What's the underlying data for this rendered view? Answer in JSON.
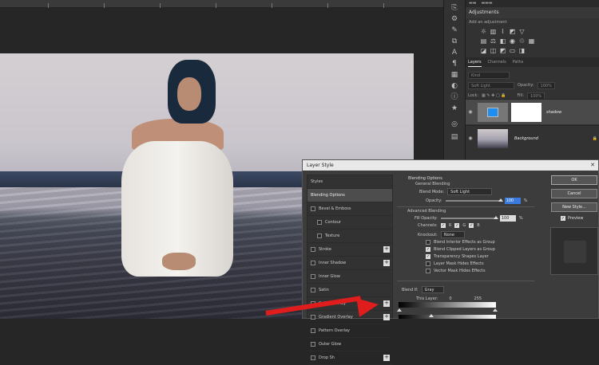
{
  "panels": {
    "adjustments_title": "Adjustments",
    "add_adjustment": "Add an adjustment",
    "layer_tabs": [
      "Layers",
      "Channels",
      "Paths"
    ],
    "filter_placeholder": "Kind",
    "blend_mode": "Soft Light",
    "opacity_label": "Opacity:",
    "opacity_value": "100%",
    "lock_label": "Lock:",
    "fill_label": "Fill:",
    "fill_value": "100%",
    "layers": [
      {
        "name": "shadow",
        "selected": true
      },
      {
        "name": "Background",
        "selected": false
      }
    ]
  },
  "dialog": {
    "title": "Layer Style",
    "styles": [
      {
        "label": "Styles",
        "type": "header"
      },
      {
        "label": "Blending Options",
        "type": "highlight"
      },
      {
        "label": "Bevel & Emboss",
        "type": "check"
      },
      {
        "label": "Contour",
        "type": "sub"
      },
      {
        "label": "Texture",
        "type": "sub"
      },
      {
        "label": "Stroke",
        "type": "check-plus"
      },
      {
        "label": "Inner Shadow",
        "type": "check-plus"
      },
      {
        "label": "Inner Glow",
        "type": "check"
      },
      {
        "label": "Satin",
        "type": "check"
      },
      {
        "label": "Color Overlay",
        "type": "check-plus"
      },
      {
        "label": "Gradient Overlay",
        "type": "check-plus"
      },
      {
        "label": "Pattern Overlay",
        "type": "check"
      },
      {
        "label": "Outer Glow",
        "type": "check"
      },
      {
        "label": "Drop Sh",
        "type": "check-plus"
      }
    ],
    "blending_options": "Blending Options",
    "general_blending": "General Blending",
    "blend_mode_label": "Blend Mode:",
    "blend_mode_value": "Soft Light",
    "opacity_label": "Opacity:",
    "opacity_value": "100",
    "opacity_pct": "%",
    "advanced_blending": "Advanced Blending",
    "fill_opacity_label": "Fill Opacity:",
    "fill_opacity_value": "100",
    "channels_label": "Channels:",
    "channels": [
      "R",
      "G",
      "B"
    ],
    "knockout_label": "Knockout:",
    "knockout_value": "None",
    "checks": [
      {
        "label": "Blend Interior Effects as Group",
        "checked": false
      },
      {
        "label": "Blend Clipped Layers as Group",
        "checked": true
      },
      {
        "label": "Transparency Shapes Layer",
        "checked": true
      },
      {
        "label": "Layer Mask Hides Effects",
        "checked": false
      },
      {
        "label": "Vector Mask Hides Effects",
        "checked": false
      }
    ],
    "blend_if_label": "Blend If:",
    "blend_if_value": "Gray",
    "this_layer_label": "This Layer:",
    "this_layer_low": "0",
    "this_layer_high": "255",
    "underlying_label": "Underlying Layer:",
    "underlying_low": "0",
    "underlying_high": "55",
    "buttons": {
      "ok": "OK",
      "cancel": "Cancel",
      "new_style": "New Style..."
    },
    "preview_label": "Preview"
  },
  "icons": [
    "eye-icon",
    "lock-icon",
    "close-icon",
    "plus-icon",
    "arrow-annotation"
  ],
  "colors": {
    "accent": "#3b7be0",
    "annotation": "#e01d1d",
    "selected_layer_thumb": "#1e8ff0"
  }
}
